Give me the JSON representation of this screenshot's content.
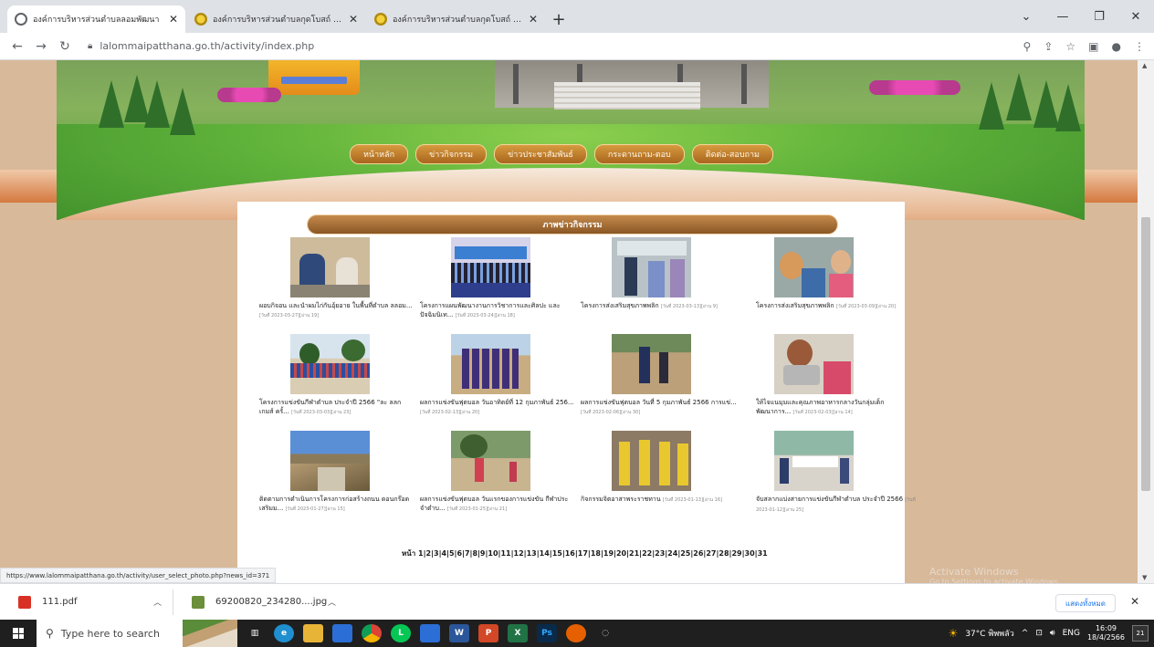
{
  "browser": {
    "tabs": [
      {
        "title": "องค์การบริหารส่วนตำบลลอมพัฒนา",
        "favicon": "globe-icon",
        "active": true
      },
      {
        "title": "องค์การบริหารส่วนตำบลกุดโบสถ์ องค์การ",
        "favicon": "seal-icon",
        "active": false
      },
      {
        "title": "องค์การบริหารส่วนตำบลกุดโบสถ์ องค์การ",
        "favicon": "seal-icon",
        "active": false
      }
    ],
    "url": "lalommaipatthana.go.th/activity/index.php"
  },
  "page": {
    "menu": [
      "หน้าหลัก",
      "ข่าวกิจกรรม",
      "ข่าวประชาสัมพันธ์",
      "กระดานถาม-ตอบ",
      "ติดต่อ-สอบถาม"
    ],
    "section_title": "ภาพข่าวกิจกรรม",
    "cards": [
      {
        "title": "ผอบกิจอน และนำผมไก่กันอุ้ยอาย ในพื้นที่ตำบล ลลอม...",
        "meta": "[วันที่ 2023-03-27][อ่าน 19]"
      },
      {
        "title": "โครงการแผนพัฒนางานการวิชาการและศิลปะ และปัจฉิมนิเท...",
        "meta": "[วันที่ 2023-03-24][อ่าน 18]"
      },
      {
        "title": "โครงการส่งเสริมสุขภาพพลิก",
        "meta": "[วันที่ 2023-03-13][อ่าน 9]"
      },
      {
        "title": "โครงการส่งเสริมสุขภาพพลิก",
        "meta": "[วันที่ 2023-03-09][อ่าน 20]"
      },
      {
        "title": "โครงการแข่งขันกีฬาตำบล ประจำปี 2566 \"ละ ลลกเกมส์ ครั้...",
        "meta": "[วันที่ 2023-03-03][อ่าน 23]"
      },
      {
        "title": "ผลการแข่งขันฟุตบอล วันอาทิตย์ที่ 12 กุมภาพันธ์ 256...",
        "meta": "[วันที่ 2023-02-13][อ่าน 20]"
      },
      {
        "title": "ผลการแข่งขันฟุตบอล วันที่ 5 กุมภาพันธ์ 2566 การแข่...",
        "meta": "[วันที่ 2023-02-06][อ่าน 30]"
      },
      {
        "title": "ให้ไจแนมุมและคุณภาพอาหารกลางวันกลุ่มเด็ก พัฒนาการ...",
        "meta": "[วันที่ 2023-02-03][อ่าน 14]"
      },
      {
        "title": "ติดตามการดำเนินการโครงการก่อสร้างถนน ดอนกร๊อดเสริมม...",
        "meta": "[วันที่ 2023-01-27][อ่าน 15]"
      },
      {
        "title": "ผลการแข่งขันฟุตบอล วันแรกของการแข่งขัน กีฬาประจำตำบ...",
        "meta": "[วันที่ 2023-01-25][อ่าน 21]"
      },
      {
        "title": "กิจกรรมจิตอาสาพระราชทาน",
        "meta": "[วันที่ 2023-01-13][อ่าน 16]"
      },
      {
        "title": "จับสลากแบ่งสายการแข่งขันกีฬาตำบล ประจำปี 2566",
        "meta": "[วันที่ 2023-01-12][อ่าน 25]"
      }
    ],
    "pager": "หน้า 1|2|3|4|5|6|7|8|9|10|11|12|13|14|15|16|17|18|19|20|21|22|23|24|25|26|27|28|29|30|31",
    "status_url": "https://www.lalommaipatthana.go.th/activity/user_select_photo.php?news_id=371",
    "activate_title": "Activate Windows",
    "activate_sub": "Go to Settings to activate Windows."
  },
  "downloads": {
    "items": [
      {
        "name": "111.pdf",
        "icon": "pdf-icon"
      },
      {
        "name": "69200820_234280....jpg",
        "icon": "image-file-icon"
      }
    ],
    "show_all": "แสดงทั้งหมด"
  },
  "taskbar": {
    "search_placeholder": "Type here to search",
    "weather": "37°C พิพพลัว",
    "lang": "ENG",
    "time": "16:09",
    "date": "18/4/2566",
    "notif_count": "21"
  }
}
